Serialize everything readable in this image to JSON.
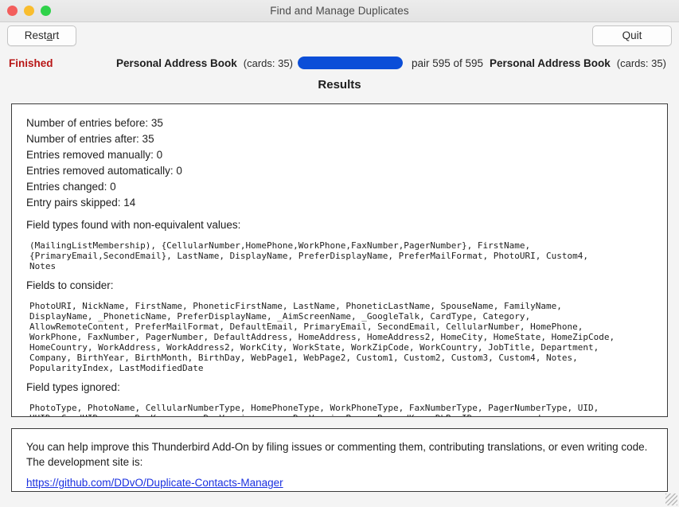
{
  "window": {
    "title": "Find and Manage Duplicates",
    "traffic_lights": [
      "close",
      "minimize",
      "maximize"
    ]
  },
  "toolbar": {
    "restart_label": "Restart",
    "restart_accesskey": "a",
    "quit_label": "Quit"
  },
  "status": {
    "state": "Finished",
    "state_color": "#b81515",
    "left_book_name": "Personal Address Book",
    "left_book_cards": "(cards: 35)",
    "right_book_name": "Personal Address Book",
    "right_book_cards": "(cards: 35)",
    "pair_label": "pair 595 of 595",
    "progress_percent": 100,
    "progress_color": "#0b4ed8"
  },
  "results": {
    "heading": "Results",
    "summary": [
      "Number of entries before: 35",
      "Number of entries after: 35",
      "Entries removed manually: 0",
      "Entries removed automatically: 0",
      "Entries changed: 0",
      "Entry pairs skipped: 14"
    ],
    "non_equivalent_title": "Field types found with non-equivalent values:",
    "non_equivalent_fields": "(MailingListMembership), {CellularNumber,HomePhone,WorkPhone,FaxNumber,PagerNumber}, FirstName,\n{PrimaryEmail,SecondEmail}, LastName, DisplayName, PreferDisplayName, PreferMailFormat, PhotoURI, Custom4,\nNotes",
    "consider_title": "Fields to consider:",
    "consider_fields": "PhotoURI, NickName, FirstName, PhoneticFirstName, LastName, PhoneticLastName, SpouseName, FamilyName,\nDisplayName, _PhoneticName, PreferDisplayName, _AimScreenName, _GoogleTalk, CardType, Category,\nAllowRemoteContent, PreferMailFormat, DefaultEmail, PrimaryEmail, SecondEmail, CellularNumber, HomePhone,\nWorkPhone, FaxNumber, PagerNumber, DefaultAddress, HomeAddress, HomeAddress2, HomeCity, HomeState, HomeZipCode,\nHomeCountry, WorkAddress, WorkAddress2, WorkCity, WorkState, WorkZipCode, WorkCountry, JobTitle, Department,\nCompany, BirthYear, BirthMonth, BirthDay, WebPage1, WebPage2, Custom1, Custom2, Custom3, Custom4, Notes,\nPopularityIndex, LastModifiedDate",
    "ignored_title": "Field types ignored:",
    "ignored_fields": "PhotoType, PhotoName, CellularNumberType, HomePhoneType, WorkPhoneType, FaxNumberType, PagerNumberType, UID,\nUUID, CardUID, groupDavKey, groupDavVersion, groupDavVersionPrev, RecordKey, DbRowID, unprocessed:rev,\nunprocessed:x-ablabel"
  },
  "info": {
    "text": "You can help improve this Thunderbird Add-On by filing issues or commenting them, contributing translations, or even writing code. The development site is:",
    "link_text": "https://github.com/DDvO/Duplicate-Contacts-Manager",
    "link_color": "#1a30e0"
  }
}
